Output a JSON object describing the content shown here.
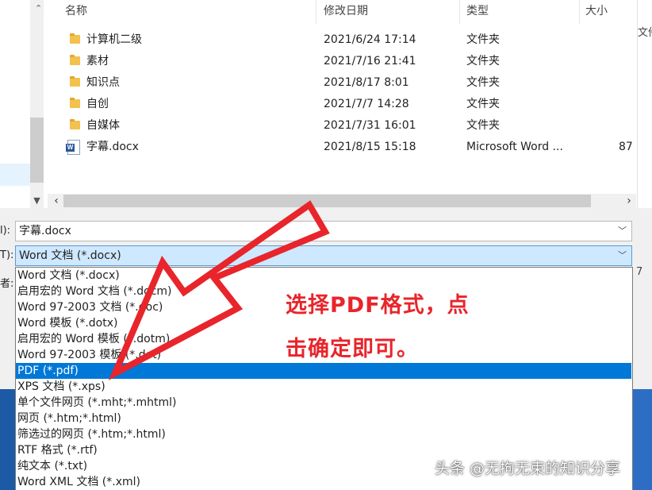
{
  "file_list": {
    "headers": {
      "name": "名称",
      "modified": "修改日期",
      "type": "类型",
      "size": "大小"
    },
    "rows": [
      {
        "icon": "folder-icon",
        "name": "计算机二级",
        "modified": "2021/6/24 17:14",
        "type": "文件夹",
        "size": ""
      },
      {
        "icon": "folder-icon",
        "name": "素材",
        "modified": "2021/7/16 21:41",
        "type": "文件夹",
        "size": ""
      },
      {
        "icon": "folder-icon",
        "name": "知识点",
        "modified": "2021/8/17 8:01",
        "type": "文件夹",
        "size": ""
      },
      {
        "icon": "folder-icon",
        "name": "自创",
        "modified": "2021/7/7 14:28",
        "type": "文件夹",
        "size": ""
      },
      {
        "icon": "folder-icon",
        "name": "自媒体",
        "modified": "2021/7/31 16:01",
        "type": "文件夹",
        "size": ""
      },
      {
        "icon": "word-doc-icon",
        "name": "字幕.docx",
        "modified": "2021/8/15 15:18",
        "type": "Microsoft Word ...",
        "size": "87"
      }
    ],
    "right_edge_text": "文件"
  },
  "form": {
    "filename_label": "l):",
    "filename_value": "字幕.docx",
    "filetype_label": "T):",
    "filetype_value": "Word 文档 (*.docx)",
    "author_label_partial": "者:",
    "right_partial": "7"
  },
  "filetype_options": [
    "Word 文档 (*.docx)",
    "启用宏的 Word 文档 (*.docm)",
    "Word 97-2003 文档 (*.doc)",
    "Word 模板 (*.dotx)",
    "启用宏的 Word 模板 (*.dotm)",
    "Word 97-2003 模板 (*.dot)",
    "PDF (*.pdf)",
    "XPS 文档 (*.xps)",
    "单个文件网页 (*.mht;*.mhtml)",
    "网页 (*.htm;*.html)",
    "筛选过的网页 (*.htm;*.html)",
    "RTF 格式 (*.rtf)",
    "纯文本 (*.txt)",
    "Word XML 文档 (*.xml)"
  ],
  "highlighted_option": "PDF (*.pdf)",
  "annotation": {
    "line1": "选择PDF格式，点",
    "line2": "击确定即可。",
    "color": "#e8252b"
  },
  "watermark": "头条 @无拘无束的知识分享",
  "colors": {
    "selection": "#0078d7",
    "field_selected": "#cde8ff",
    "folder": "#f2c14e"
  }
}
